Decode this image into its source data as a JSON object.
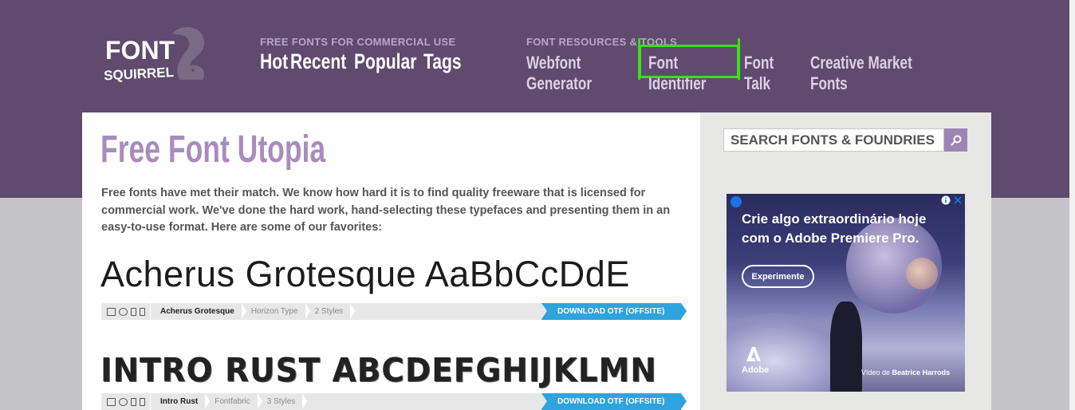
{
  "header": {
    "logo_text_top": "FONT",
    "logo_text_bottom": "SQUIRREL",
    "cat1_label": "FREE FONTS FOR COMMERCIAL USE",
    "cat1_links": [
      "Hot",
      "Recent",
      "Popular",
      "Tags"
    ],
    "cat2_label": "FONT RESOURCES & TOOLS",
    "cat2_links": [
      "Webfont Generator",
      "Font Identifier",
      "Font Talk",
      "Creative Market Fonts"
    ]
  },
  "main": {
    "title": "Free Font Utopia",
    "intro": "Free fonts have met their match. We know how hard it is to find quality freeware that is licensed for commercial work. We've done the hard work, hand-selecting these typefaces and presenting them in an easy-to-use format. Here are some of our favorites:",
    "fonts": [
      {
        "sample": "Acherus Grotesque AaBbCcDdE",
        "name": "Acherus Grotesque",
        "foundry": "Horizon Type",
        "styles": "2 Styles",
        "download": "DOWNLOAD OTF (OFFSITE)"
      },
      {
        "sample": "INTRO RUST ABCDEFGHIJKLMN",
        "name": "Intro Rust",
        "foundry": "Fontfabric",
        "styles": "3 Styles",
        "download": "DOWNLOAD OTF (OFFSITE)"
      }
    ]
  },
  "sidebar": {
    "search_placeholder": "SEARCH FONTS & FOUNDRIES",
    "ad": {
      "headline": "Crie algo extraordinário hoje com o Adobe Premiere Pro.",
      "button": "Experimente",
      "brand": "Adobe",
      "credit_prefix": "Vídeo de",
      "credit_name": "Beatrice Harrods"
    }
  },
  "colors": {
    "header_bg": "#604a6d",
    "title_purple": "#a98bbd",
    "download_blue": "#2fa3dd",
    "highlight_green": "#3ae019"
  }
}
